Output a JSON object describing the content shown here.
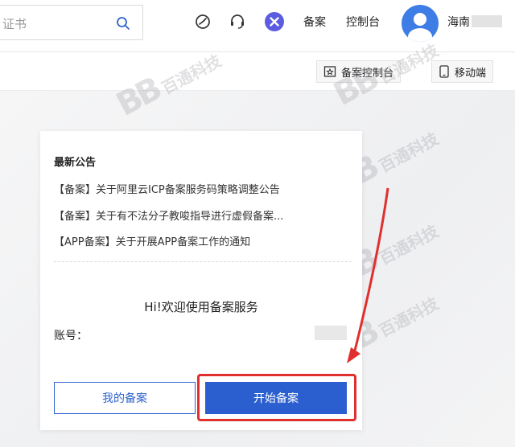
{
  "header": {
    "search_placeholder": "证书",
    "link_beian": "备案",
    "link_console": "控制台",
    "user_name": "海南"
  },
  "subbar": {
    "console_btn": "备案控制台",
    "mobile_btn": "移动端"
  },
  "card": {
    "notice_title": "最新公告",
    "notices": [
      "【备案】关于阿里云ICP备案服务码策略调整公告",
      "【备案】关于有不法分子教唆指导进行虚假备案...",
      "【APP备案】关于开展APP备案工作的通知"
    ],
    "welcome": "Hi!欢迎使用备案服务",
    "account_label": "账号：",
    "my_beian_btn": "我的备案",
    "start_beian_btn": "开始备案"
  },
  "watermark": {
    "logo": "BB",
    "text": "百通科技"
  },
  "colors": {
    "primary": "#2b5fcf",
    "annotation_red": "#e0302e"
  }
}
